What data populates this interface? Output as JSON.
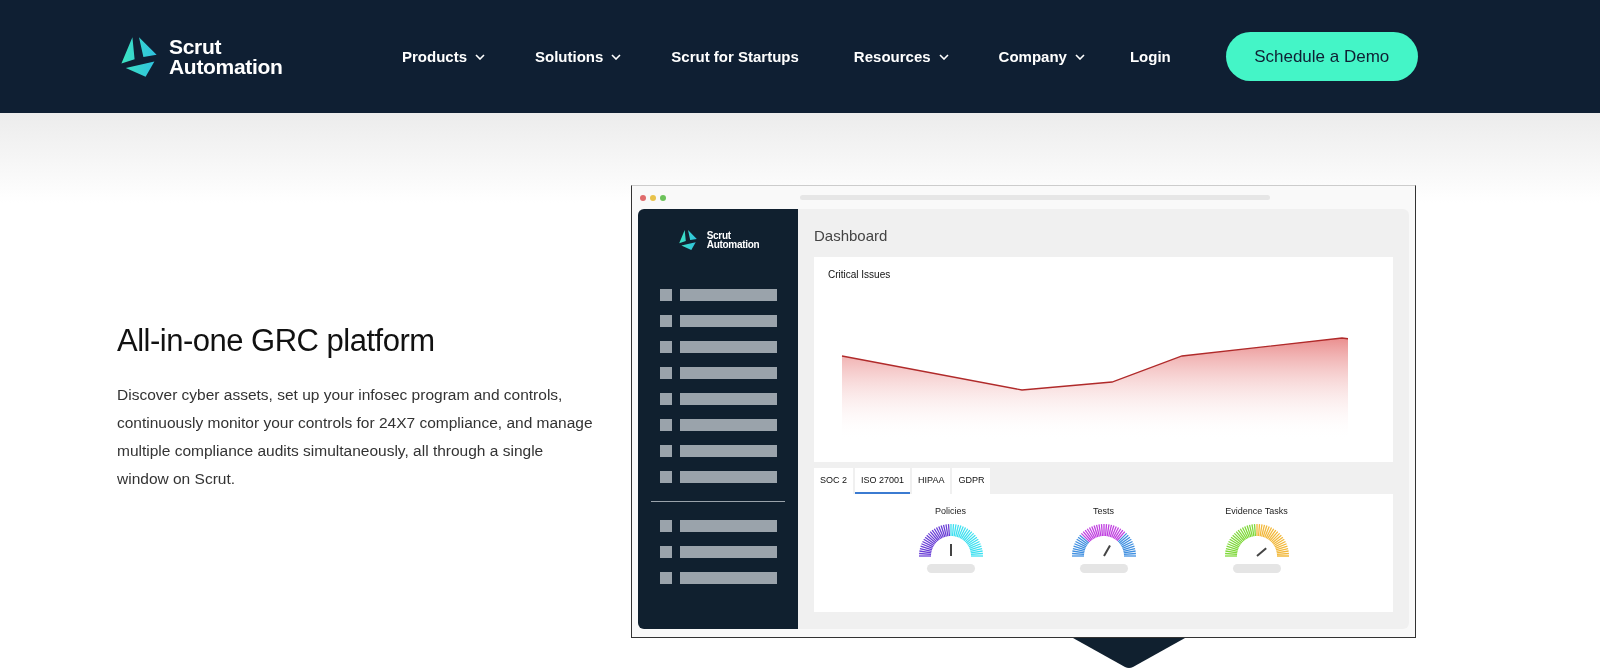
{
  "header": {
    "logo": {
      "line1": "Scrut",
      "line2": "Automation"
    },
    "nav": [
      {
        "label": "Products",
        "dropdown": true
      },
      {
        "label": "Solutions",
        "dropdown": true
      },
      {
        "label": "Scrut for Startups",
        "dropdown": false
      },
      {
        "label": "Resources",
        "dropdown": true
      },
      {
        "label": "Company",
        "dropdown": true
      },
      {
        "label": "Login",
        "dropdown": false
      }
    ],
    "cta": "Schedule a Demo"
  },
  "hero": {
    "title": "All-in-one GRC platform",
    "body": "Discover cyber assets, set up your infosec program and controls, continuously monitor your controls for 24X7 compliance, and manage multiple compliance audits simultaneously, all through a single window on Scrut."
  },
  "mockup": {
    "logo": {
      "line1": "Scrut",
      "line2": "Automation"
    },
    "title": "Dashboard",
    "chart_title": "Critical Issues",
    "tabs": [
      {
        "label": "SOC 2",
        "selected": false
      },
      {
        "label": "ISO 27001",
        "selected": true
      },
      {
        "label": "HIPAA",
        "selected": false
      },
      {
        "label": "GDPR",
        "selected": false
      }
    ],
    "gauges": [
      {
        "label": "Policies"
      },
      {
        "label": "Tests"
      },
      {
        "label": "Evidence Tasks"
      }
    ]
  }
}
